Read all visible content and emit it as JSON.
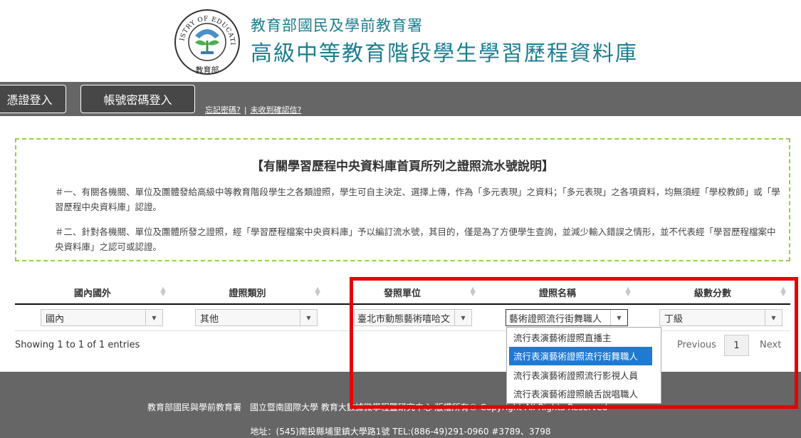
{
  "header": {
    "agency": "教育部國民及學前教育署",
    "title": "高級中等教育階段學生學習歷程資料庫",
    "logo_text_top": "MINISTRY OF EDUCATION",
    "logo_text_bottom": "教育部"
  },
  "nav": {
    "cert_login": "憑證登入",
    "account_login": "帳號密碼登入",
    "forgot_password": "忘記密碼?",
    "separator": "|",
    "no_confirmation": "未收到確認信?"
  },
  "notice": {
    "title": "【有關學習歷程中央資料庫首頁所列之證照流水號說明】",
    "p1": "＃一、有關各機關、單位及團體發給高級中等教育階段學生之各類證照，學生可自主決定、選擇上傳，作為「多元表現」之資料；「多元表現」之各項資料，均無須經「學校教師」或「學習歷程中央資料庫」認證。",
    "p2": "＃二、針對各機關、單位及團體所發之證照，經「學習歷程檔案中央資料庫」予以編訂流水號，其目的，僅是為了方便學生查詢，並減少輸入錯誤之情形，並不代表經「學習歷程檔案中央資料庫」之認可或認證。"
  },
  "table": {
    "columns": [
      "國內國外",
      "證照類別",
      "發照單位",
      "證照名稱",
      "級數分數"
    ],
    "filters": [
      "國內",
      "其他",
      "臺北市動態藝術嘻哈文",
      "藝術證照流行街舞職人",
      "丁級"
    ],
    "sort_icon": "sort-icon"
  },
  "dropdown": {
    "options": [
      "流行表演藝術證照直播主",
      "流行表演藝術證照流行街舞職人",
      "流行表演藝術證照流行影視人員",
      "流行表演藝術證照饒舌說唱職人"
    ],
    "selected_index": 1
  },
  "pagination": {
    "info": "Showing 1 to 1 of 1 entries",
    "previous": "Previous",
    "page": "1",
    "next": "Next"
  },
  "footer": {
    "line1": "教育部國民與學前教育署　國立暨南國際大學 教育大數據微學程暨研究中心 版權所有© Copyright All Rights Reserved",
    "line2": "地址：(545)南投縣埔里鎮大學路1號 TEL:(886-49)291-0960 #3789、3798"
  },
  "colors": {
    "brand": "#1c7e8f",
    "nav_bg": "#666666",
    "notice_border": "#92d050",
    "highlight": "#1e7ad3",
    "annotation": "#e60000"
  }
}
